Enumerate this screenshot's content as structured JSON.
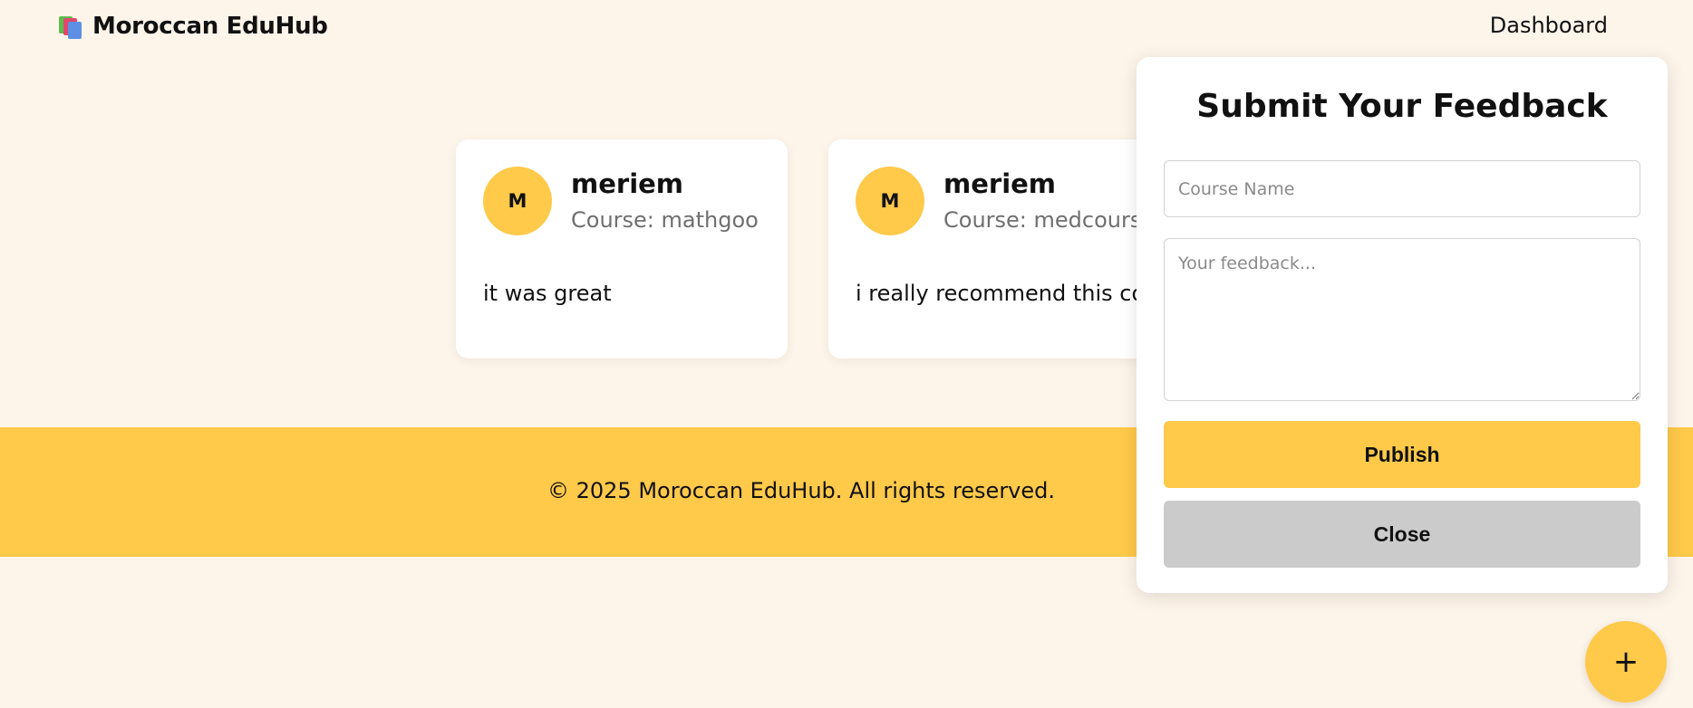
{
  "header": {
    "brand": "Moroccan EduHub",
    "brand_icon": "books-icon",
    "nav_dashboard": "Dashboard"
  },
  "feedback_cards": [
    {
      "avatar_initial": "M",
      "name": "meriem",
      "course": "Course: mathgoo",
      "text": "it was great"
    },
    {
      "avatar_initial": "M",
      "name": "meriem",
      "course": "Course: medcourse",
      "text": "i really recommend this course"
    }
  ],
  "footer": {
    "copyright": "© 2025 Moroccan EduHub. All rights reserved."
  },
  "modal": {
    "title": "Submit Your Feedback",
    "course_placeholder": "Course Name",
    "course_value": "",
    "feedback_placeholder": "Your feedback...",
    "feedback_value": "",
    "publish_label": "Publish",
    "close_label": "Close"
  },
  "fab": {
    "label": "+",
    "icon": "plus-icon"
  },
  "colors": {
    "background": "#fdf4ea",
    "accent": "#ffc94a",
    "close_button": "#cbcbcb",
    "card": "#ffffff"
  }
}
